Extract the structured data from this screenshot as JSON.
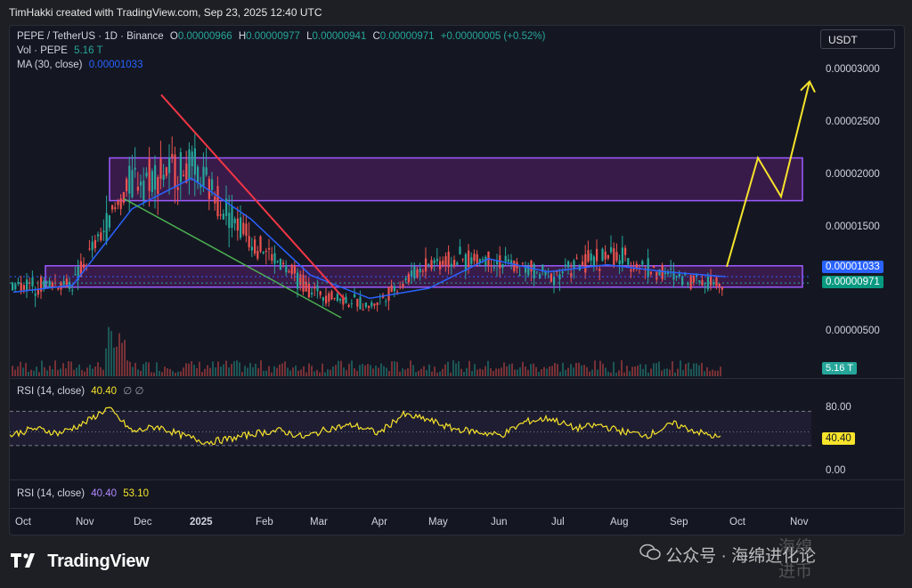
{
  "caption": "TimHakki created with TradingView.com, Sep 23, 2025 12:40 UTC",
  "header": {
    "symbol": "PEPE / TetherUS · 1D · Binance",
    "o_label": "O",
    "o_val": "0.00000966",
    "h_label": "H",
    "h_val": "0.00000977",
    "l_label": "L",
    "l_val": "0.00000941",
    "c_label": "C",
    "c_val": "0.00000971",
    "change": "+0.00000005 (+0.52%)",
    "vol_label": "Vol · PEPE",
    "vol_val": "5.16 T",
    "ma_label": "MA (30, close)",
    "ma_val": "0.00001033"
  },
  "currency_button": "USDT",
  "price_axis": [
    "0.00003000",
    "0.00002500",
    "0.00002000",
    "0.00001500",
    "0.00000500"
  ],
  "price_tags": {
    "ma": "0.00001033",
    "last": "0.00000971",
    "volume": "5.16 T"
  },
  "rsi_pane": {
    "label": "RSI (14, close)",
    "value": "40.40",
    "extra": "∅ ∅",
    "levels": [
      "80.00",
      "0.00"
    ],
    "tag": "40.40"
  },
  "rsi_pane2": {
    "label": "RSI (14, close)",
    "value": "40.40",
    "ma_value": "53.10"
  },
  "x_axis": [
    "Oct",
    "Nov",
    "Dec",
    "2025",
    "Feb",
    "Mar",
    "Apr",
    "May",
    "Jun",
    "Jul",
    "Aug",
    "Sep",
    "Oct",
    "Nov"
  ],
  "footer": {
    "brand": "TradingView"
  },
  "watermark": {
    "text": "公众号 · 海绵进化论",
    "overlay": "海绵进币"
  },
  "colors": {
    "up": "#26a69a",
    "down": "#ef5350",
    "ma": "#2962ff",
    "rsi": "#f7e32b",
    "zone": "#9c27b0",
    "trend_down": "#f23645",
    "trend_support": "#4caf50",
    "projection": "#f7e32b"
  },
  "chart_data": {
    "type": "line",
    "title": "PEPE / TetherUS · 1D · Binance",
    "x": [
      "Oct",
      "Nov",
      "Dec",
      "2025",
      "Feb",
      "Mar",
      "Apr",
      "May",
      "Jun",
      "Jul",
      "Aug",
      "Sep",
      "Oct",
      "Nov"
    ],
    "ylim": [
      4e-06,
      3.15e-05
    ],
    "series": [
      {
        "name": "PEPE / TetherUS",
        "values": [
          9.5e-06,
          9.7e-06,
          2e-05,
          2.1e-05,
          1.4e-05,
          9e-06,
          7.4e-06,
          1.18e-05,
          1.21e-05,
          1.04e-05,
          1.25e-05,
          1.05e-05,
          9.7e-06
        ]
      },
      {
        "name": "MA (30, close)",
        "values": [
          8.8e-06,
          9.5e-06,
          1.7e-05,
          2e-05,
          1.6e-05,
          1.05e-05,
          8.2e-06,
          9.2e-06,
          1.21e-05,
          1.08e-05,
          1.15e-05,
          1.08e-05,
          1.033e-05
        ]
      }
    ],
    "zones": [
      {
        "from": 1.78e-05,
        "to": 2.2e-05
      },
      {
        "from": 9.3e-06,
        "to": 1.14e-05
      }
    ],
    "projection": [
      1.13e-05,
      2.2e-05,
      1.82e-05,
      2.95e-05
    ],
    "rsi": {
      "name": "RSI (14, close)",
      "levels": [
        80,
        50,
        30
      ],
      "values": [
        45,
        55,
        48,
        62,
        85,
        50,
        58,
        45,
        35,
        40,
        48,
        52,
        42,
        55,
        60,
        48,
        75,
        68,
        55,
        50,
        45,
        65,
        70,
        55,
        60,
        50,
        45,
        62,
        50,
        40
      ]
    }
  }
}
